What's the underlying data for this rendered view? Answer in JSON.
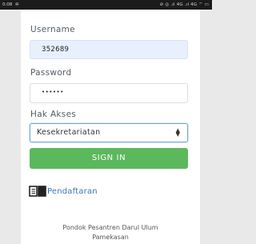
{
  "status_bar": {
    "time": "0:08",
    "left_icon": "notification-icon",
    "right_icons": "⊘ ◎ .ıl 4G .ıl 4G ⌔ ▭"
  },
  "form": {
    "username_label": "Username",
    "username_value": "352689",
    "password_label": "Password",
    "password_value": "••••••",
    "access_label": "Hak Akses",
    "access_selected": "Kesekretariatan",
    "signin_label": "SIGN IN"
  },
  "register": {
    "icon": "book-icon",
    "label": "Pendaftaran"
  },
  "footer": {
    "line1": "Pondok Pesantren Darul Ulum",
    "line2": "Pamekasan"
  },
  "colors": {
    "signin": "#5cb85c",
    "link": "#3377bb",
    "autofill": "#e8f0fe",
    "focus_border": "#6fa8dc"
  }
}
